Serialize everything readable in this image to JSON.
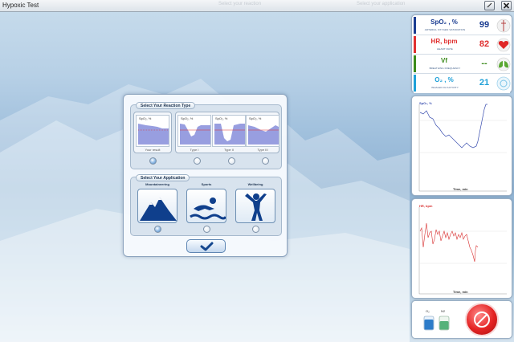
{
  "window": {
    "title": "Hypoxic Test",
    "faint_center": "Select your reaction",
    "faint_right": "Select your application"
  },
  "dialog": {
    "reaction_group": {
      "title": "Select Your Reaction Type",
      "thumb_label": "SpO₂, %",
      "captions": [
        "Your result",
        "Type I",
        "Type II",
        "Type III"
      ],
      "selected_index": 0
    },
    "application_group": {
      "title": "Select Your Application",
      "labels": [
        "Mountaineering",
        "Sports",
        "Wellbeing"
      ],
      "selected_index": 0
    }
  },
  "vitals": [
    {
      "name": "SpO₂ , %",
      "sub": "ARTERIAL OXYGEN SATURATION",
      "value": "99",
      "color": "#1b3d91",
      "icon": "lungs-body-icon"
    },
    {
      "name": "HR, bpm",
      "sub": "HEART RATE",
      "value": "82",
      "color": "#e03030",
      "icon": "heart-icon"
    },
    {
      "name": "Vf",
      "sub": "BREATHING FREQUENCY",
      "value": "--",
      "color": "#3a8a1a",
      "icon": "lungs-icon"
    },
    {
      "name": "O₂ , %",
      "sub": "INHALED O2 ACTIVITY",
      "value": "21",
      "color": "#1ea0d8",
      "icon": "o2-sensor-icon"
    }
  ],
  "charts": [
    {
      "title": "SpO₂, %",
      "xlabel": "Time, min",
      "color": "#3b4fb0"
    },
    {
      "title": "HR, bpm",
      "xlabel": "Time, min",
      "color": "#d83030"
    }
  ],
  "gas": {
    "o2_label": "O₂",
    "n2_label": "N2"
  }
}
